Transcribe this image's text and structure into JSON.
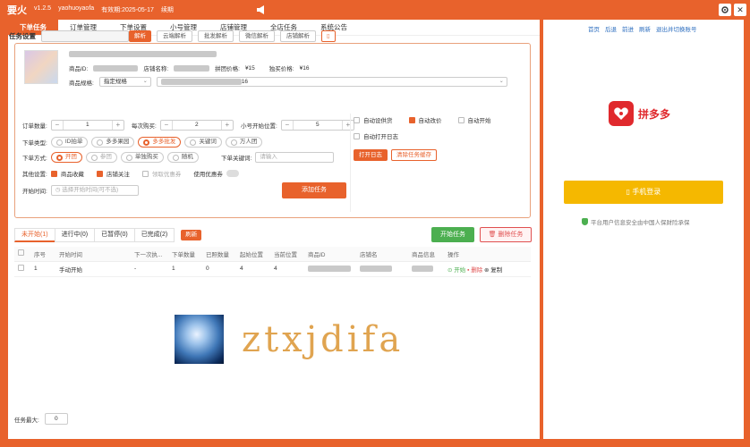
{
  "titlebar": {
    "app_name": "要火",
    "version": "v1.2.5",
    "user": "yaohuoyaofa",
    "expiry": "有效期:2025-05-17",
    "renew": "续期",
    "close_label": "✕"
  },
  "tabs": [
    "下单任务",
    "订单管理",
    "下单设置",
    "小号管理",
    "店铺管理",
    "全店任务",
    "系统公告"
  ],
  "task_setting": {
    "label": "任务设置",
    "parse_button": "解析",
    "parse_buttons": [
      "云端解析",
      "批发解析",
      "微信解析",
      "店铺解析"
    ]
  },
  "product": {
    "id_label": "商品ID:",
    "shop_label": "店铺名称:",
    "group_price_label": "拼团价格:",
    "group_price": "¥15",
    "single_price_label": "独买价格:",
    "single_price": "¥16",
    "spec_label": "商品规格:",
    "spec_select": "指定规格",
    "spec_suffix": "16"
  },
  "form": {
    "order_qty_label": "订单数量:",
    "order_qty": "1",
    "per_buy_label": "每次购买:",
    "per_buy": "2",
    "start_pos_label": "小号开始位置:",
    "start_pos": "5",
    "order_type_label": "下单类型:",
    "order_types": [
      "ID拍单",
      "多多果园",
      "多多批发",
      "关键词",
      "万人团"
    ],
    "order_mode_label": "下单方式:",
    "order_modes": [
      "开团",
      "参团",
      "单独购买",
      "随机"
    ],
    "keyword_label": "下单关键词:",
    "keyword_placeholder": "请输入",
    "other_label": "其他设置:",
    "other_options": [
      "商品收藏",
      "店铺关注",
      "领取优惠券",
      "使用优惠券"
    ],
    "start_time_label": "开始时间:",
    "start_time_placeholder": "选择开始时间(可不选)",
    "add_task": "添加任务"
  },
  "auto": {
    "options": [
      "自动设供货",
      "自动改价",
      "自动开始",
      "自动打开日志"
    ],
    "open_log": "打开日志",
    "clear_cache": "清除任务缓存"
  },
  "subtabs": [
    "未开始(1)",
    "进行中(0)",
    "已暂停(0)",
    "已完成(2)"
  ],
  "refresh": "刷新",
  "start_task": "开始任务",
  "delete_task": "删除任务",
  "table": {
    "headers": [
      "序号",
      "开始时间",
      "下一次执...",
      "下单数量",
      "已照数量",
      "起始位置",
      "当前位置",
      "商品ID",
      "店铺名",
      "商品信息",
      "操作"
    ],
    "rows": [
      {
        "index": "1",
        "start": "手动开始",
        "next": "-",
        "qty": "1",
        "done": "0",
        "start_pos": "4",
        "cur_pos": "4"
      }
    ],
    "ops": [
      "开始",
      "删除",
      "复制"
    ]
  },
  "watermark": {
    "text": "ztxjdifa"
  },
  "max_task": {
    "label": "任务最大:",
    "value": "0"
  },
  "right": {
    "links": [
      "首页",
      "后退",
      "前进",
      "刷新",
      "退出并切换账号"
    ],
    "brand": "拼多多",
    "login_button": "手机登录",
    "safety": "平台用户信息安全由中国人保财险承保"
  }
}
